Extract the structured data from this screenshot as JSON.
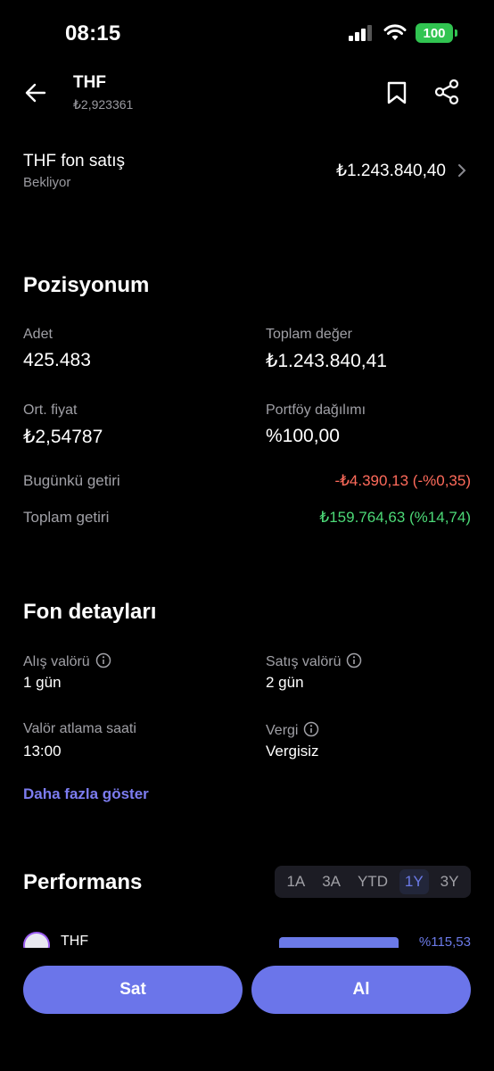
{
  "status_bar": {
    "time": "08:15",
    "battery": "100"
  },
  "header": {
    "title": "THF",
    "price": "₺2,923361"
  },
  "order": {
    "title": "THF fon satış",
    "status": "Bekliyor",
    "amount": "₺1.243.840,40"
  },
  "position": {
    "title": "Pozisyonum",
    "fields": [
      {
        "label": "Adet",
        "value": "425.483"
      },
      {
        "label": "Toplam değer",
        "value": "₺1.243.840,41"
      },
      {
        "label": "Ort. fiyat",
        "value": "₺2,54787"
      },
      {
        "label": "Portföy dağılımı",
        "value": "%100,00"
      }
    ],
    "returns": [
      {
        "label": "Bugünkü getiri",
        "value": "-₺4.390,13 (-%0,35)",
        "color": "#ff6b5b"
      },
      {
        "label": "Toplam getiri",
        "value": "₺159.764,63 (%14,74)",
        "color": "#4cd977"
      }
    ]
  },
  "fund_details": {
    "title": "Fon detayları",
    "fields": [
      {
        "label": "Alış valörü",
        "value": "1 gün",
        "info_icon": "info-icon"
      },
      {
        "label": "Satış valörü",
        "value": "2 gün",
        "info_icon": "info-icon"
      },
      {
        "label": "Valör atlama saati",
        "value": "13:00"
      },
      {
        "label": "Vergi",
        "value": "Vergisiz",
        "info_icon": "info-icon"
      }
    ],
    "show_more": "Daha fazla göster"
  },
  "performance": {
    "title": "Performans",
    "tabs": [
      "1A",
      "3A",
      "YTD",
      "1Y",
      "3Y"
    ],
    "active_tab": "1Y",
    "fund_name": "THF",
    "fund_value": "%115,53"
  },
  "actions": {
    "sell": "Sat",
    "buy": "Al"
  },
  "colors": {
    "accent": "#6b75ea",
    "negative": "#ff6b5b",
    "positive": "#4cd977"
  }
}
